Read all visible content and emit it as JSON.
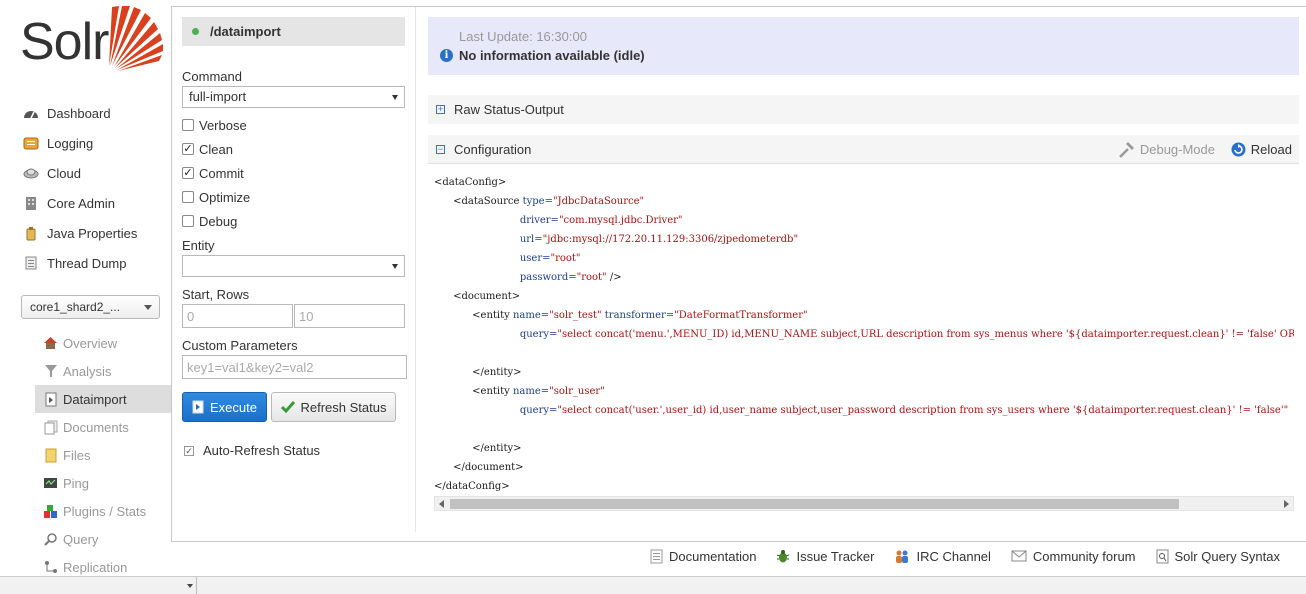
{
  "brand": {
    "name": "Solr"
  },
  "nav": [
    {
      "label": "Dashboard",
      "icon": "dashboard-icon"
    },
    {
      "label": "Logging",
      "icon": "logging-icon"
    },
    {
      "label": "Cloud",
      "icon": "cloud-icon"
    },
    {
      "label": "Core Admin",
      "icon": "core-admin-icon"
    },
    {
      "label": "Java Properties",
      "icon": "java-icon"
    },
    {
      "label": "Thread Dump",
      "icon": "thread-dump-icon"
    }
  ],
  "core_selector": {
    "value": "core1_shard2_..."
  },
  "core_nav": [
    {
      "label": "Overview",
      "icon": "home-icon"
    },
    {
      "label": "Analysis",
      "icon": "filter-icon"
    },
    {
      "label": "Dataimport",
      "icon": "dataimport-icon",
      "active": true
    },
    {
      "label": "Documents",
      "icon": "documents-icon"
    },
    {
      "label": "Files",
      "icon": "files-icon"
    },
    {
      "label": "Ping",
      "icon": "ping-icon"
    },
    {
      "label": "Plugins / Stats",
      "icon": "plugins-icon"
    },
    {
      "label": "Query",
      "icon": "query-icon"
    },
    {
      "label": "Replication",
      "icon": "replication-icon"
    }
  ],
  "form": {
    "handler": "/dataimport",
    "command_label": "Command",
    "command_value": "full-import",
    "checkboxes": [
      {
        "label": "Verbose",
        "checked": false
      },
      {
        "label": "Clean",
        "checked": true
      },
      {
        "label": "Commit",
        "checked": true
      },
      {
        "label": "Optimize",
        "checked": false
      },
      {
        "label": "Debug",
        "checked": false
      }
    ],
    "entity_label": "Entity",
    "entity_value": "",
    "start_rows_label": "Start, Rows",
    "start_placeholder": "0",
    "rows_placeholder": "10",
    "custom_params_label": "Custom Parameters",
    "custom_params_placeholder": "key1=val1&key2=val2",
    "execute_label": "Execute",
    "refresh_label": "Refresh Status",
    "auto_refresh_label": "Auto-Refresh Status",
    "auto_refresh_checked": true
  },
  "status": {
    "last_update": "Last Update: 16:30:00",
    "message": "No information available (idle)"
  },
  "raw_status": {
    "label": "Raw Status-Output"
  },
  "configuration": {
    "label": "Configuration",
    "debug_mode_label": "Debug-Mode",
    "reload_label": "Reload",
    "lines": [
      {
        "indent": 0,
        "parts": [
          [
            "tag",
            "<dataConfig>"
          ]
        ]
      },
      {
        "indent": 1,
        "parts": [
          [
            "tag",
            "<dataSource "
          ],
          [
            "attr",
            "type="
          ],
          [
            "val",
            "\"JdbcDataSource\""
          ]
        ]
      },
      {
        "indent": 3,
        "parts": [
          [
            "attr",
            "driver="
          ],
          [
            "val",
            "\"com.mysql.jdbc.Driver\""
          ]
        ]
      },
      {
        "indent": 3,
        "parts": [
          [
            "attr",
            "url="
          ],
          [
            "val",
            "\"jdbc:mysql://172.20.11.129:3306/zjpedometerdb\""
          ]
        ]
      },
      {
        "indent": 3,
        "parts": [
          [
            "attr",
            "user="
          ],
          [
            "val",
            "\"root\""
          ]
        ]
      },
      {
        "indent": 3,
        "parts": [
          [
            "attr",
            "password="
          ],
          [
            "val",
            "\"root\""
          ],
          [
            "tag",
            " />"
          ]
        ]
      },
      {
        "indent": 1,
        "parts": [
          [
            "tag",
            "<document>"
          ]
        ]
      },
      {
        "indent": 2,
        "parts": [
          [
            "tag",
            "<entity "
          ],
          [
            "attr",
            "name="
          ],
          [
            "val",
            "\"solr_test\""
          ],
          [
            "tag",
            " "
          ],
          [
            "attr",
            "transformer="
          ],
          [
            "val",
            "\"DateFormatTransformer\""
          ]
        ]
      },
      {
        "indent": 3,
        "parts": [
          [
            "attr",
            "query="
          ],
          [
            "val",
            "\"select concat('menu.',MENU_ID) id,MENU_NAME subject,URL description from sys_menus where '${dataimporter.request.clean}' != 'false' OR update_time > '${dataimporter.last_index_time}'\""
          ]
        ]
      },
      {
        "indent": 0,
        "parts": []
      },
      {
        "indent": 2,
        "parts": [
          [
            "tag",
            "</entity>"
          ]
        ]
      },
      {
        "indent": 2,
        "parts": [
          [
            "tag",
            "<entity "
          ],
          [
            "attr",
            "name="
          ],
          [
            "val",
            "\"solr_user\""
          ]
        ]
      },
      {
        "indent": 3,
        "parts": [
          [
            "attr",
            "query="
          ],
          [
            "val",
            "\"select concat('user.',user_id) id,user_name subject,user_password description from sys_users where '${dataimporter.request.clean}' != 'false'\""
          ]
        ]
      },
      {
        "indent": 0,
        "parts": []
      },
      {
        "indent": 2,
        "parts": [
          [
            "tag",
            "</entity>"
          ]
        ]
      },
      {
        "indent": 1,
        "parts": [
          [
            "tag",
            "</document>"
          ]
        ]
      },
      {
        "indent": 0,
        "parts": [
          [
            "tag",
            "</dataConfig>"
          ]
        ]
      }
    ]
  },
  "footer": [
    {
      "label": "Documentation",
      "icon": "documentation-icon"
    },
    {
      "label": "Issue Tracker",
      "icon": "bug-icon"
    },
    {
      "label": "IRC Channel",
      "icon": "irc-icon"
    },
    {
      "label": "Community forum",
      "icon": "mail-icon"
    },
    {
      "label": "Solr Query Syntax",
      "icon": "query-syntax-icon"
    }
  ],
  "colors": {
    "accent": "#d9411e",
    "primary_button": "#1b6fc7",
    "status_bg": "#e8e8fb",
    "active_nav": "#dddddd"
  }
}
